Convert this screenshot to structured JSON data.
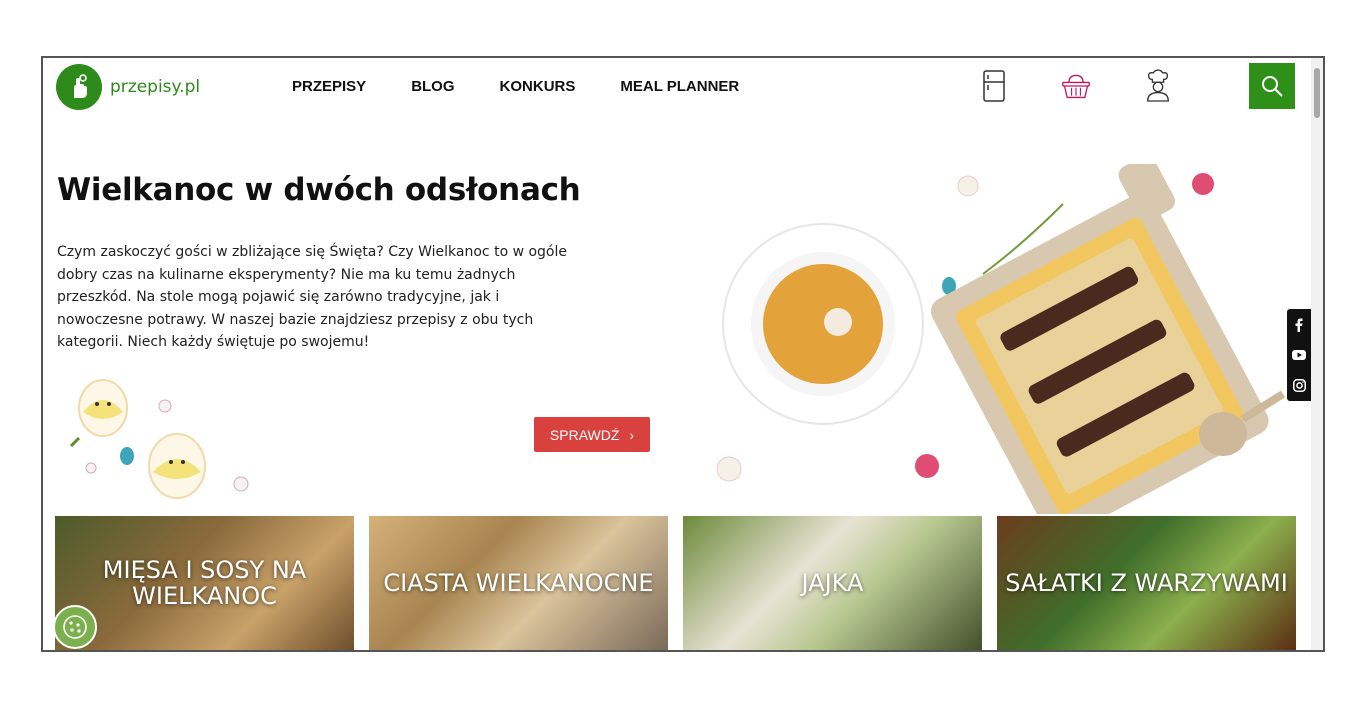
{
  "site": {
    "logo_text": "przepisy.pl",
    "brand_color": "#2f8a1c"
  },
  "nav": {
    "items": [
      {
        "label": "PRZEPISY"
      },
      {
        "label": "BLOG"
      },
      {
        "label": "KONKURS"
      },
      {
        "label": "MEAL PLANNER"
      }
    ]
  },
  "header_icons": [
    "fridge-icon",
    "shopping-basket-icon",
    "chef-icon",
    "search-icon"
  ],
  "hero": {
    "title": "Wielkanoc w dwóch odsłonach",
    "text": "Czym zaskoczyć gości w zbliżające się Święta? Czy Wielkanoc to w ogóle dobry czas na kulinarne eksperymenty? Nie ma ku temu żadnych przeszkód. Na stole mogą pojawić się zarówno tradycyjne, jak i nowoczesne potrawy. W naszej bazie znajdziesz przepisy z obu tych kategorii. Niech każdy świętuje po swojemu!",
    "button_label": "SPRAWDŹ",
    "button_color": "#d8413e"
  },
  "social": [
    "facebook-icon",
    "youtube-icon",
    "instagram-icon"
  ],
  "categories": [
    {
      "label": "MIĘSA I SOSY NA WIELKANOC"
    },
    {
      "label": "CIASTA WIELKANOCNE"
    },
    {
      "label": "JAJKA"
    },
    {
      "label": "SAŁATKI Z WARZYWAMI"
    }
  ]
}
